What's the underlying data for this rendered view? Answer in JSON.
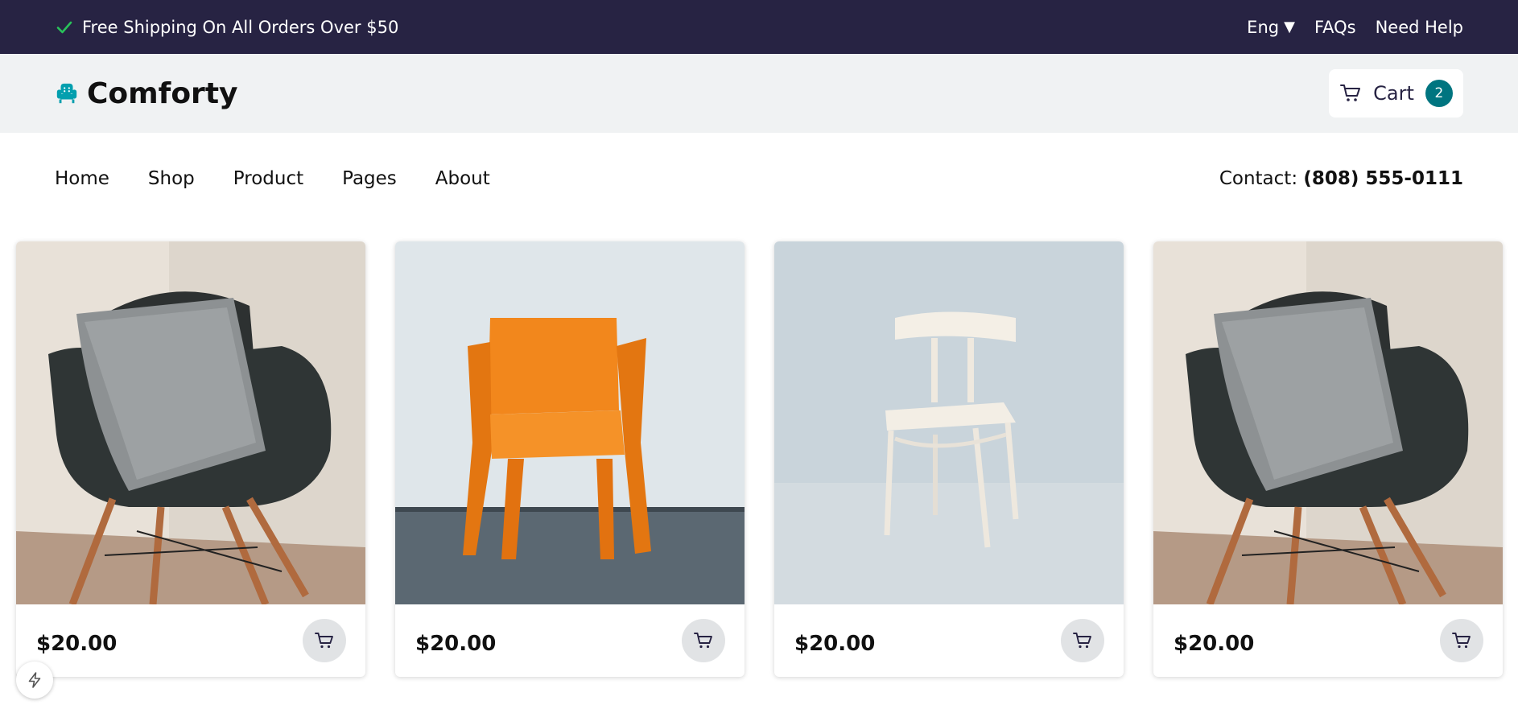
{
  "topbar": {
    "shipping_text": "Free Shipping On All Orders Over $50",
    "language": "Eng",
    "faqs": "FAQs",
    "help": "Need Help"
  },
  "header": {
    "brand": "Comforty",
    "cart_label": "Cart",
    "cart_count": "2"
  },
  "nav": {
    "items": [
      {
        "label": "Home"
      },
      {
        "label": "Shop"
      },
      {
        "label": "Product"
      },
      {
        "label": "Pages"
      },
      {
        "label": "About"
      }
    ],
    "contact_label": "Contact:",
    "contact_phone": "(808) 555-0111"
  },
  "products": [
    {
      "price": "$20.00",
      "image": "black-chair-with-pillow"
    },
    {
      "price": "$20.00",
      "image": "orange-chair"
    },
    {
      "price": "$20.00",
      "image": "white-wooden-chair"
    },
    {
      "price": "$20.00",
      "image": "black-chair-with-pillow"
    }
  ],
  "colors": {
    "topbar_bg": "#272343",
    "header_bg": "#f0f2f3",
    "accent": "#007580",
    "check": "#29c25a"
  }
}
